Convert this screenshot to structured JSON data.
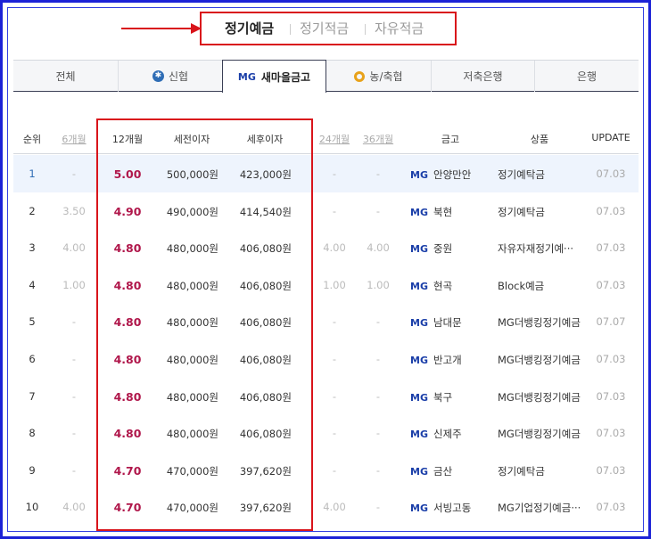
{
  "product_tabs": [
    {
      "label": "정기예금",
      "active": true
    },
    {
      "label": "정기적금",
      "active": false
    },
    {
      "label": "자유적금",
      "active": false
    }
  ],
  "institution_tabs": [
    {
      "label": "전체",
      "icon": "",
      "active": false
    },
    {
      "label": "신협",
      "icon": "shinhyup-icon",
      "active": false
    },
    {
      "label": "새마을금고",
      "icon": "mg-icon",
      "icon_text": "MG",
      "active": true
    },
    {
      "label": "농/축협",
      "icon": "nonghyup-icon",
      "active": false
    },
    {
      "label": "저축은행",
      "icon": "",
      "active": false
    },
    {
      "label": "은행",
      "icon": "",
      "active": false
    }
  ],
  "table": {
    "headers": {
      "rank": "순위",
      "m6": "6개월",
      "m12": "12개월",
      "pretax": "세전이자",
      "posttax": "세후이자",
      "m24": "24개월",
      "m36": "36개월",
      "bank": "금고",
      "product": "상품",
      "update": "UPDATE"
    },
    "bank_icon_text": "MG",
    "rows": [
      {
        "rank": "1",
        "m6": "-",
        "m12": "5.00",
        "pretax": "500,000원",
        "posttax": "423,000원",
        "m24": "-",
        "m36": "-",
        "bank": "안양만안",
        "product": "정기예탁금",
        "update": "07.03"
      },
      {
        "rank": "2",
        "m6": "3.50",
        "m12": "4.90",
        "pretax": "490,000원",
        "posttax": "414,540원",
        "m24": "-",
        "m36": "-",
        "bank": "북현",
        "product": "정기예탁금",
        "update": "07.03"
      },
      {
        "rank": "3",
        "m6": "4.00",
        "m12": "4.80",
        "pretax": "480,000원",
        "posttax": "406,080원",
        "m24": "4.00",
        "m36": "4.00",
        "bank": "중원",
        "product": "자유자재정기예···",
        "update": "07.03"
      },
      {
        "rank": "4",
        "m6": "1.00",
        "m12": "4.80",
        "pretax": "480,000원",
        "posttax": "406,080원",
        "m24": "1.00",
        "m36": "1.00",
        "bank": "현곡",
        "product": "Block예금",
        "update": "07.03"
      },
      {
        "rank": "5",
        "m6": "-",
        "m12": "4.80",
        "pretax": "480,000원",
        "posttax": "406,080원",
        "m24": "-",
        "m36": "-",
        "bank": "남대문",
        "product": "MG더뱅킹정기예금",
        "update": "07.07"
      },
      {
        "rank": "6",
        "m6": "-",
        "m12": "4.80",
        "pretax": "480,000원",
        "posttax": "406,080원",
        "m24": "-",
        "m36": "-",
        "bank": "반고개",
        "product": "MG더뱅킹정기예금",
        "update": "07.03"
      },
      {
        "rank": "7",
        "m6": "-",
        "m12": "4.80",
        "pretax": "480,000원",
        "posttax": "406,080원",
        "m24": "-",
        "m36": "-",
        "bank": "북구",
        "product": "MG더뱅킹정기예금",
        "update": "07.03"
      },
      {
        "rank": "8",
        "m6": "-",
        "m12": "4.80",
        "pretax": "480,000원",
        "posttax": "406,080원",
        "m24": "-",
        "m36": "-",
        "bank": "신제주",
        "product": "MG더뱅킹정기예금",
        "update": "07.03"
      },
      {
        "rank": "9",
        "m6": "-",
        "m12": "4.70",
        "pretax": "470,000원",
        "posttax": "397,620원",
        "m24": "-",
        "m36": "-",
        "bank": "금산",
        "product": "정기예탁금",
        "update": "07.03"
      },
      {
        "rank": "10",
        "m6": "4.00",
        "m12": "4.70",
        "pretax": "470,000원",
        "posttax": "397,620원",
        "m24": "4.00",
        "m36": "-",
        "bank": "서빙고동",
        "product": "MG기업정기예금···",
        "update": "07.03"
      }
    ]
  },
  "colors": {
    "frame": "#1c22d6",
    "highlight_box": "#d9141b",
    "rate_12m": "#b0174b",
    "mg_brand": "#1a3ea8"
  }
}
